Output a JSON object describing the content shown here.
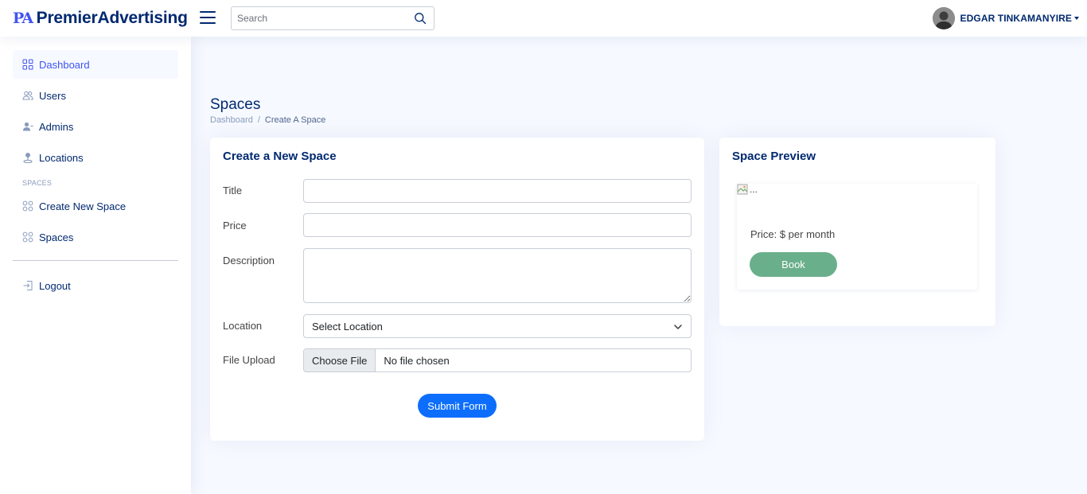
{
  "header": {
    "logo_mark": "PA",
    "logo_text": "PremierAdvertising",
    "search_placeholder": "Search",
    "profile_name": "EDGAR TINKAMANYIRE"
  },
  "sidebar": {
    "items": [
      {
        "label": "Dashboard",
        "icon": "grid-icon",
        "active": true
      },
      {
        "label": "Users",
        "icon": "users-icon"
      },
      {
        "label": "Admins",
        "icon": "admin-icon"
      },
      {
        "label": "Locations",
        "icon": "location-person-icon"
      }
    ],
    "section_heading": "SPACES",
    "section_items": [
      {
        "label": "Create New Space",
        "icon": "circles-grid-icon"
      },
      {
        "label": "Spaces",
        "icon": "circles-grid-icon"
      }
    ],
    "logout_label": "Logout"
  },
  "main": {
    "page_title": "Spaces",
    "breadcrumb": [
      {
        "label": "Dashboard"
      },
      {
        "label": "/"
      },
      {
        "label": "Create A Space"
      }
    ],
    "form": {
      "title": "Create a New Space",
      "fields": {
        "title_label": "Title",
        "title_value": "",
        "price_label": "Price",
        "price_value": "",
        "description_label": "Description",
        "description_value": "",
        "location_label": "Location",
        "location_selected": "Select Location",
        "file_label": "File Upload",
        "file_button": "Choose File",
        "file_status": "No file chosen"
      },
      "submit_label": "Submit Form"
    },
    "preview": {
      "title": "Space Preview",
      "image_alt": "...",
      "price_text": "Price: $ per month",
      "book_label": "Book"
    }
  },
  "colors": {
    "brand": "#012970",
    "accent": "#4154f1",
    "primary_button": "#0d6efd",
    "book_button": "#6aaf8b",
    "page_background": "#f6f9ff"
  }
}
